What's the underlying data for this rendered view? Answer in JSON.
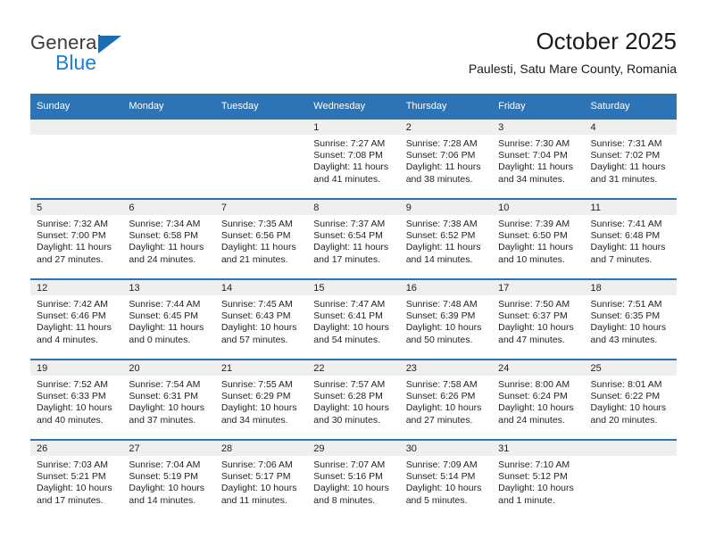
{
  "brand": {
    "name_top": "General",
    "name_bottom": "Blue",
    "accent_color": "#1b6cb0",
    "accent_color_light": "#1b7fd4"
  },
  "header": {
    "title": "October 2025",
    "subtitle": "Paulesti, Satu Mare County, Romania"
  },
  "theme": {
    "header_blue": "#2e74b5",
    "band_gray": "#efefef",
    "text": "#231f20"
  },
  "weekday_headers": [
    "Sunday",
    "Monday",
    "Tuesday",
    "Wednesday",
    "Thursday",
    "Friday",
    "Saturday"
  ],
  "weeks": [
    [
      {
        "day": "",
        "lines": []
      },
      {
        "day": "",
        "lines": []
      },
      {
        "day": "",
        "lines": []
      },
      {
        "day": "1",
        "lines": [
          "Sunrise: 7:27 AM",
          "Sunset: 7:08 PM",
          "Daylight: 11 hours",
          "and 41 minutes."
        ]
      },
      {
        "day": "2",
        "lines": [
          "Sunrise: 7:28 AM",
          "Sunset: 7:06 PM",
          "Daylight: 11 hours",
          "and 38 minutes."
        ]
      },
      {
        "day": "3",
        "lines": [
          "Sunrise: 7:30 AM",
          "Sunset: 7:04 PM",
          "Daylight: 11 hours",
          "and 34 minutes."
        ]
      },
      {
        "day": "4",
        "lines": [
          "Sunrise: 7:31 AM",
          "Sunset: 7:02 PM",
          "Daylight: 11 hours",
          "and 31 minutes."
        ]
      }
    ],
    [
      {
        "day": "5",
        "lines": [
          "Sunrise: 7:32 AM",
          "Sunset: 7:00 PM",
          "Daylight: 11 hours",
          "and 27 minutes."
        ]
      },
      {
        "day": "6",
        "lines": [
          "Sunrise: 7:34 AM",
          "Sunset: 6:58 PM",
          "Daylight: 11 hours",
          "and 24 minutes."
        ]
      },
      {
        "day": "7",
        "lines": [
          "Sunrise: 7:35 AM",
          "Sunset: 6:56 PM",
          "Daylight: 11 hours",
          "and 21 minutes."
        ]
      },
      {
        "day": "8",
        "lines": [
          "Sunrise: 7:37 AM",
          "Sunset: 6:54 PM",
          "Daylight: 11 hours",
          "and 17 minutes."
        ]
      },
      {
        "day": "9",
        "lines": [
          "Sunrise: 7:38 AM",
          "Sunset: 6:52 PM",
          "Daylight: 11 hours",
          "and 14 minutes."
        ]
      },
      {
        "day": "10",
        "lines": [
          "Sunrise: 7:39 AM",
          "Sunset: 6:50 PM",
          "Daylight: 11 hours",
          "and 10 minutes."
        ]
      },
      {
        "day": "11",
        "lines": [
          "Sunrise: 7:41 AM",
          "Sunset: 6:48 PM",
          "Daylight: 11 hours",
          "and 7 minutes."
        ]
      }
    ],
    [
      {
        "day": "12",
        "lines": [
          "Sunrise: 7:42 AM",
          "Sunset: 6:46 PM",
          "Daylight: 11 hours",
          "and 4 minutes."
        ]
      },
      {
        "day": "13",
        "lines": [
          "Sunrise: 7:44 AM",
          "Sunset: 6:45 PM",
          "Daylight: 11 hours",
          "and 0 minutes."
        ]
      },
      {
        "day": "14",
        "lines": [
          "Sunrise: 7:45 AM",
          "Sunset: 6:43 PM",
          "Daylight: 10 hours",
          "and 57 minutes."
        ]
      },
      {
        "day": "15",
        "lines": [
          "Sunrise: 7:47 AM",
          "Sunset: 6:41 PM",
          "Daylight: 10 hours",
          "and 54 minutes."
        ]
      },
      {
        "day": "16",
        "lines": [
          "Sunrise: 7:48 AM",
          "Sunset: 6:39 PM",
          "Daylight: 10 hours",
          "and 50 minutes."
        ]
      },
      {
        "day": "17",
        "lines": [
          "Sunrise: 7:50 AM",
          "Sunset: 6:37 PM",
          "Daylight: 10 hours",
          "and 47 minutes."
        ]
      },
      {
        "day": "18",
        "lines": [
          "Sunrise: 7:51 AM",
          "Sunset: 6:35 PM",
          "Daylight: 10 hours",
          "and 43 minutes."
        ]
      }
    ],
    [
      {
        "day": "19",
        "lines": [
          "Sunrise: 7:52 AM",
          "Sunset: 6:33 PM",
          "Daylight: 10 hours",
          "and 40 minutes."
        ]
      },
      {
        "day": "20",
        "lines": [
          "Sunrise: 7:54 AM",
          "Sunset: 6:31 PM",
          "Daylight: 10 hours",
          "and 37 minutes."
        ]
      },
      {
        "day": "21",
        "lines": [
          "Sunrise: 7:55 AM",
          "Sunset: 6:29 PM",
          "Daylight: 10 hours",
          "and 34 minutes."
        ]
      },
      {
        "day": "22",
        "lines": [
          "Sunrise: 7:57 AM",
          "Sunset: 6:28 PM",
          "Daylight: 10 hours",
          "and 30 minutes."
        ]
      },
      {
        "day": "23",
        "lines": [
          "Sunrise: 7:58 AM",
          "Sunset: 6:26 PM",
          "Daylight: 10 hours",
          "and 27 minutes."
        ]
      },
      {
        "day": "24",
        "lines": [
          "Sunrise: 8:00 AM",
          "Sunset: 6:24 PM",
          "Daylight: 10 hours",
          "and 24 minutes."
        ]
      },
      {
        "day": "25",
        "lines": [
          "Sunrise: 8:01 AM",
          "Sunset: 6:22 PM",
          "Daylight: 10 hours",
          "and 20 minutes."
        ]
      }
    ],
    [
      {
        "day": "26",
        "lines": [
          "Sunrise: 7:03 AM",
          "Sunset: 5:21 PM",
          "Daylight: 10 hours",
          "and 17 minutes."
        ]
      },
      {
        "day": "27",
        "lines": [
          "Sunrise: 7:04 AM",
          "Sunset: 5:19 PM",
          "Daylight: 10 hours",
          "and 14 minutes."
        ]
      },
      {
        "day": "28",
        "lines": [
          "Sunrise: 7:06 AM",
          "Sunset: 5:17 PM",
          "Daylight: 10 hours",
          "and 11 minutes."
        ]
      },
      {
        "day": "29",
        "lines": [
          "Sunrise: 7:07 AM",
          "Sunset: 5:16 PM",
          "Daylight: 10 hours",
          "and 8 minutes."
        ]
      },
      {
        "day": "30",
        "lines": [
          "Sunrise: 7:09 AM",
          "Sunset: 5:14 PM",
          "Daylight: 10 hours",
          "and 5 minutes."
        ]
      },
      {
        "day": "31",
        "lines": [
          "Sunrise: 7:10 AM",
          "Sunset: 5:12 PM",
          "Daylight: 10 hours",
          "and 1 minute."
        ]
      },
      {
        "day": "",
        "lines": []
      }
    ]
  ]
}
